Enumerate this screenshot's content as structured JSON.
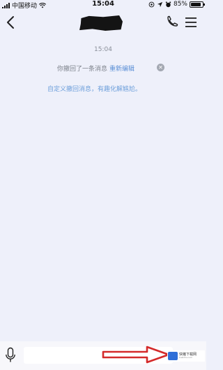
{
  "status_bar": {
    "carrier": "中国移动",
    "time": "15:04",
    "battery": "85%",
    "battery_level": 0.85
  },
  "nav": {
    "back_icon": "chevron-left-icon",
    "title_redacted": true,
    "call_icon": "phone-icon",
    "menu_icon": "hamburger-menu-icon"
  },
  "chat": {
    "timestamp": "15:04",
    "recall_notice": "你撤回了一条消息",
    "reedit_link": "重新编辑",
    "close_icon": "close-icon",
    "custom_recall_tip": "自定义撤回消息，有趣化解尴尬。"
  },
  "input_bar": {
    "mic_icon": "microphone-icon",
    "input_value": "",
    "input_placeholder": ""
  },
  "overlay": {
    "arrow_color": "#d42a2a",
    "watermark_text": "快猪下载网",
    "watermark_sub": "kuaizhu.com"
  },
  "colors": {
    "background": "#eef0fa",
    "link": "#5b8fd6",
    "tip": "#6d9fdb"
  }
}
